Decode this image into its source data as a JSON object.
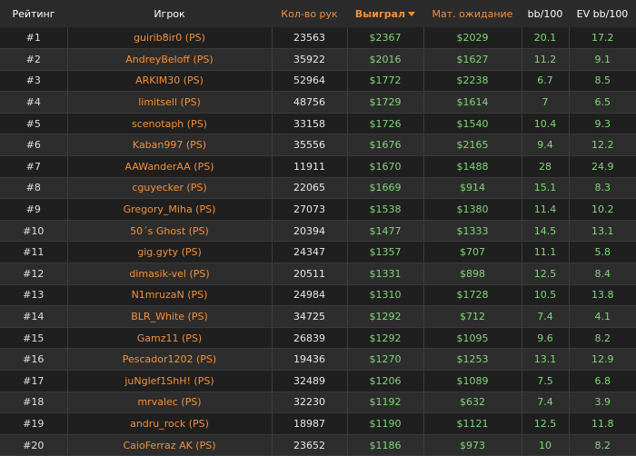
{
  "headers": {
    "rank": "Рейтинг",
    "player": "Игрок",
    "hands": "Кол-во рук",
    "won": "Выиграл",
    "ev": "Мат. ожидание",
    "bb100": "bb/100",
    "evbb100": "EV bb/100"
  },
  "colors": {
    "accent": "#f3913a",
    "positive": "#80d676",
    "background": "#2b2b2b"
  },
  "rows": [
    {
      "rank": "#1",
      "player": "guirib8ir0 (PS)",
      "hands": "23563",
      "won": "$2367",
      "ev": "$2029",
      "bb100": "20.1",
      "evbb100": "17.2"
    },
    {
      "rank": "#2",
      "player": "AndreyBeloff (PS)",
      "hands": "35922",
      "won": "$2016",
      "ev": "$1627",
      "bb100": "11.2",
      "evbb100": "9.1"
    },
    {
      "rank": "#3",
      "player": "ARKIM30 (PS)",
      "hands": "52964",
      "won": "$1772",
      "ev": "$2238",
      "bb100": "6.7",
      "evbb100": "8.5"
    },
    {
      "rank": "#4",
      "player": "limitsell (PS)",
      "hands": "48756",
      "won": "$1729",
      "ev": "$1614",
      "bb100": "7",
      "evbb100": "6.5"
    },
    {
      "rank": "#5",
      "player": "scenotaph (PS)",
      "hands": "33158",
      "won": "$1726",
      "ev": "$1540",
      "bb100": "10.4",
      "evbb100": "9.3"
    },
    {
      "rank": "#6",
      "player": "Kaban997 (PS)",
      "hands": "35556",
      "won": "$1676",
      "ev": "$2165",
      "bb100": "9.4",
      "evbb100": "12.2"
    },
    {
      "rank": "#7",
      "player": "AAWanderAA (PS)",
      "hands": "11911",
      "won": "$1670",
      "ev": "$1488",
      "bb100": "28",
      "evbb100": "24.9"
    },
    {
      "rank": "#8",
      "player": "cguyecker (PS)",
      "hands": "22065",
      "won": "$1669",
      "ev": "$914",
      "bb100": "15.1",
      "evbb100": "8.3"
    },
    {
      "rank": "#9",
      "player": "Gregory_Miha (PS)",
      "hands": "27073",
      "won": "$1538",
      "ev": "$1380",
      "bb100": "11.4",
      "evbb100": "10.2"
    },
    {
      "rank": "#10",
      "player": "50´s Ghost (PS)",
      "hands": "20394",
      "won": "$1477",
      "ev": "$1333",
      "bb100": "14.5",
      "evbb100": "13.1"
    },
    {
      "rank": "#11",
      "player": "gig.gyty (PS)",
      "hands": "24347",
      "won": "$1357",
      "ev": "$707",
      "bb100": "11.1",
      "evbb100": "5.8"
    },
    {
      "rank": "#12",
      "player": "dimasik-vel (PS)",
      "hands": "20511",
      "won": "$1331",
      "ev": "$898",
      "bb100": "12.5",
      "evbb100": "8.4"
    },
    {
      "rank": "#13",
      "player": "N1mruzaN (PS)",
      "hands": "24984",
      "won": "$1310",
      "ev": "$1728",
      "bb100": "10.5",
      "evbb100": "13.8"
    },
    {
      "rank": "#14",
      "player": "BLR_White (PS)",
      "hands": "34725",
      "won": "$1292",
      "ev": "$712",
      "bb100": "7.4",
      "evbb100": "4.1"
    },
    {
      "rank": "#15",
      "player": "Gamz11 (PS)",
      "hands": "26839",
      "won": "$1292",
      "ev": "$1095",
      "bb100": "9.6",
      "evbb100": "8.2"
    },
    {
      "rank": "#16",
      "player": "Pescador1202 (PS)",
      "hands": "19436",
      "won": "$1270",
      "ev": "$1253",
      "bb100": "13.1",
      "evbb100": "12.9"
    },
    {
      "rank": "#17",
      "player": "juNglef1ShH! (PS)",
      "hands": "32489",
      "won": "$1206",
      "ev": "$1089",
      "bb100": "7.5",
      "evbb100": "6.8"
    },
    {
      "rank": "#18",
      "player": "mrvalec (PS)",
      "hands": "32230",
      "won": "$1192",
      "ev": "$632",
      "bb100": "7.4",
      "evbb100": "3.9"
    },
    {
      "rank": "#19",
      "player": "andru_rock (PS)",
      "hands": "18987",
      "won": "$1190",
      "ev": "$1121",
      "bb100": "12.5",
      "evbb100": "11.8"
    },
    {
      "rank": "#20",
      "player": "CaioFerraz AK (PS)",
      "hands": "23652",
      "won": "$1186",
      "ev": "$973",
      "bb100": "10",
      "evbb100": "8.2"
    }
  ]
}
